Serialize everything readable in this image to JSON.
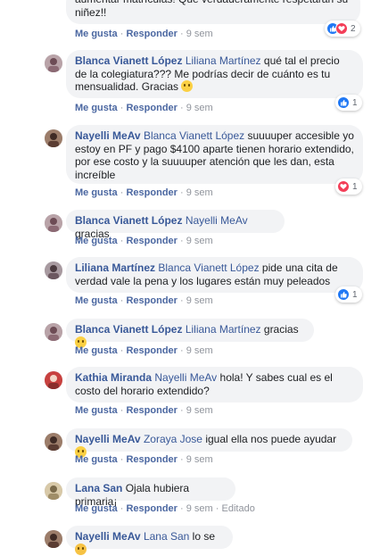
{
  "comments": [
    {
      "author": "",
      "mention": "",
      "text": "aumentar matrículas! Que verdaderamente respetarán su niñez!!",
      "like_label": "Me gusta",
      "reply_label": "Responder",
      "time": "9 sem",
      "reactions": [
        "like",
        "love"
      ],
      "reaction_count": "2"
    },
    {
      "author": "Blanca Vianett López",
      "mention": "Liliana Martínez",
      "text": "qué tal el precio de la colegiatura??? Me podrías decir de cuánto es tu mensualidad. Gracias",
      "like_label": "Me gusta",
      "reply_label": "Responder",
      "time": "9 sem",
      "reactions": [
        "like"
      ],
      "reaction_count": "1"
    },
    {
      "author": "Nayelli MeAv",
      "mention": "Blanca Vianett López",
      "text": "suuuuper accesible yo estoy en PF y pago $4100 aparte tienen horario extendido, por ese costo y la suuuuper atención que les dan, esta increíble",
      "like_label": "Me gusta",
      "reply_label": "Responder",
      "time": "9 sem",
      "reactions": [
        "love"
      ],
      "reaction_count": "1"
    },
    {
      "author": "Blanca Vianett López",
      "mention": "Nayelli MeAv",
      "text": "gracias",
      "like_label": "Me gusta",
      "reply_label": "Responder",
      "time": "9 sem"
    },
    {
      "author": "Liliana Martínez",
      "mention": "Blanca Vianett López",
      "text": "pide una cita de verdad vale la pena y los lugares están muy peleados",
      "like_label": "Me gusta",
      "reply_label": "Responder",
      "time": "9 sem",
      "reactions": [
        "like"
      ],
      "reaction_count": "1"
    },
    {
      "author": "Blanca Vianett López",
      "mention": "Liliana Martínez",
      "text": "gracias",
      "like_label": "Me gusta",
      "reply_label": "Responder",
      "time": "9 sem"
    },
    {
      "author": "Kathia Miranda",
      "mention": "Nayelli MeAv",
      "text": "hola! Y sabes cual es el costo del horario extendido?",
      "like_label": "Me gusta",
      "reply_label": "Responder",
      "time": "9 sem"
    },
    {
      "author": "Nayelli MeAv",
      "mention": "Zoraya Jose",
      "text": "igual ella nos puede ayudar",
      "like_label": "Me gusta",
      "reply_label": "Responder",
      "time": "9 sem"
    },
    {
      "author": "Lana San",
      "mention": "",
      "text": "Ojala hubiera primaria¡",
      "like_label": "Me gusta",
      "reply_label": "Responder",
      "time": "9 sem",
      "edited": "Editado"
    },
    {
      "author": "Nayelli MeAv",
      "mention": "Lana San",
      "text": "lo se"
    }
  ],
  "colors": {
    "link": "#385898",
    "bubble": "#f2f3f5",
    "like": "#2078f4",
    "love": "#f33e58",
    "meta": "#90949c"
  }
}
